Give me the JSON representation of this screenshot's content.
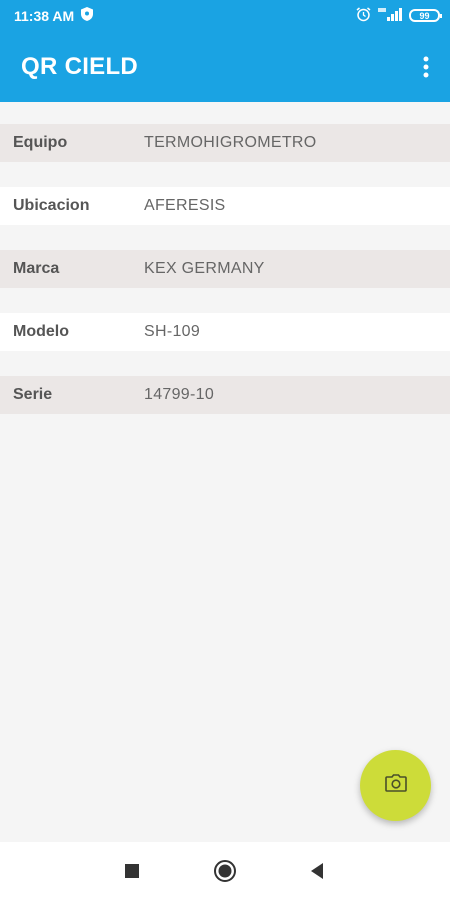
{
  "status_bar": {
    "time": "11:38 AM",
    "battery": "99",
    "icons": [
      "shield-icon",
      "alarm-icon",
      "signal-icon",
      "battery-icon"
    ]
  },
  "app_bar": {
    "title": "QR CIELD",
    "menu_icon": "more-vert-icon"
  },
  "details": [
    {
      "label": "Equipo",
      "value": "TERMOHIGROMETRO"
    },
    {
      "label": "Ubicacion",
      "value": "AFERESIS"
    },
    {
      "label": "Marca",
      "value": "KEX GERMANY"
    },
    {
      "label": "Modelo",
      "value": "SH-109"
    },
    {
      "label": "Serie",
      "value": "14799-10"
    }
  ],
  "fab": {
    "icon": "camera-icon"
  },
  "nav": {
    "icons": [
      "recents-icon",
      "home-icon",
      "back-icon"
    ]
  },
  "colors": {
    "primary": "#1aa3e3",
    "fab": "#cddc39",
    "row_shaded": "#ebe7e6",
    "background": "#f5f5f5"
  }
}
